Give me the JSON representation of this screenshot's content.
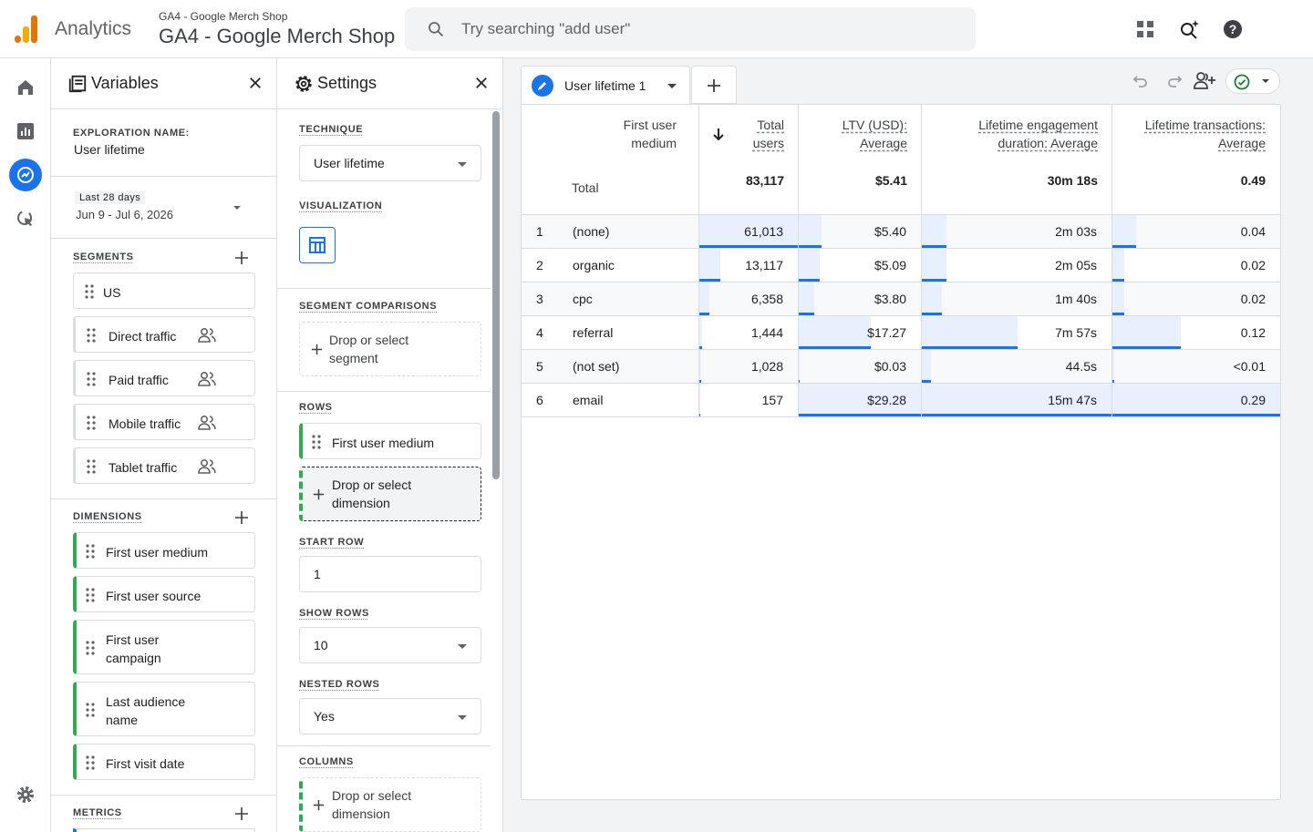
{
  "header": {
    "app_name": "Analytics",
    "property_sub": "GA4 - Google Merch Shop",
    "property_main": "GA4 - Google Merch Shop",
    "search_placeholder": "Try searching \"add user\""
  },
  "variables": {
    "title": "Variables",
    "exploration_label": "EXPLORATION NAME:",
    "exploration_name": "User lifetime",
    "date_badge": "Last 28 days",
    "date_range": "Jun 9 - Jul 6, 2026",
    "segments_label": "SEGMENTS",
    "segments": [
      "US",
      "Direct traffic",
      "Paid traffic",
      "Mobile traffic",
      "Tablet traffic"
    ],
    "dimensions_label": "DIMENSIONS",
    "dimensions": [
      "First user medium",
      "First user source",
      "First user campaign",
      "Last audience name",
      "First visit date"
    ],
    "metrics_label": "METRICS"
  },
  "settings": {
    "title": "Settings",
    "technique_label": "TECHNIQUE",
    "technique": "User lifetime",
    "visualization_label": "VISUALIZATION",
    "segment_comparisons_label": "SEGMENT COMPARISONS",
    "drop_segment": "Drop or select segment",
    "rows_label": "ROWS",
    "row_dimension": "First user medium",
    "drop_dimension": "Drop or select dimension",
    "start_row_label": "START ROW",
    "start_row": "1",
    "show_rows_label": "SHOW ROWS",
    "show_rows": "10",
    "nested_rows_label": "NESTED ROWS",
    "nested_rows": "Yes",
    "columns_label": "COLUMNS",
    "drop_column": "Drop or select dimension"
  },
  "tab": {
    "label": "User lifetime 1"
  },
  "table": {
    "headers": {
      "dimension": "First user medium",
      "c1": "Total users",
      "c2": "LTV (USD): Average",
      "c3": "Lifetime engagement duration: Average",
      "c4": "Lifetime transactions: Average"
    },
    "total": {
      "label": "Total",
      "c1": "83,117",
      "c2": "$5.41",
      "c3": "30m 18s",
      "c4": "0.49"
    },
    "rows": [
      {
        "n": "1",
        "dim": "(none)",
        "c1": "61,013",
        "c2": "$5.40",
        "c3": "2m 03s",
        "c4": "0.04",
        "f1": 1.0,
        "f2": 0.184,
        "f3": 0.13,
        "f4": 0.14
      },
      {
        "n": "2",
        "dim": "organic",
        "c1": "13,117",
        "c2": "$5.09",
        "c3": "2m 05s",
        "c4": "0.02",
        "f1": 0.215,
        "f2": 0.174,
        "f3": 0.132,
        "f4": 0.07
      },
      {
        "n": "3",
        "dim": "cpc",
        "c1": "6,358",
        "c2": "$3.80",
        "c3": "1m 40s",
        "c4": "0.02",
        "f1": 0.104,
        "f2": 0.13,
        "f3": 0.106,
        "f4": 0.07
      },
      {
        "n": "4",
        "dim": "referral",
        "c1": "1,444",
        "c2": "$17.27",
        "c3": "7m 57s",
        "c4": "0.12",
        "f1": 0.024,
        "f2": 0.59,
        "f3": 0.504,
        "f4": 0.41
      },
      {
        "n": "5",
        "dim": "(not set)",
        "c1": "1,028",
        "c2": "$0.03",
        "c3": "44.5s",
        "c4": "<0.01",
        "f1": 0.017,
        "f2": 0.01,
        "f3": 0.047,
        "f4": 0.01
      },
      {
        "n": "6",
        "dim": "email",
        "c1": "157",
        "c2": "$29.28",
        "c3": "15m 47s",
        "c4": "0.29",
        "f1": 0.003,
        "f2": 1.0,
        "f3": 1.0,
        "f4": 1.0
      }
    ]
  },
  "icons": [
    "search-icon",
    "apps-icon",
    "sparkle-search-icon",
    "help-icon",
    "home-icon",
    "reports-icon",
    "explore-icon",
    "advertising-icon",
    "settings-gear-icon",
    "undo-icon",
    "redo-icon",
    "share-user-icon",
    "check-circle-icon"
  ],
  "colors": {
    "accent": "#1a73e8",
    "bar": "#e8f0fe",
    "green": "#34a853",
    "logo_orange": "#f9ab00",
    "logo_dark": "#e37400"
  }
}
